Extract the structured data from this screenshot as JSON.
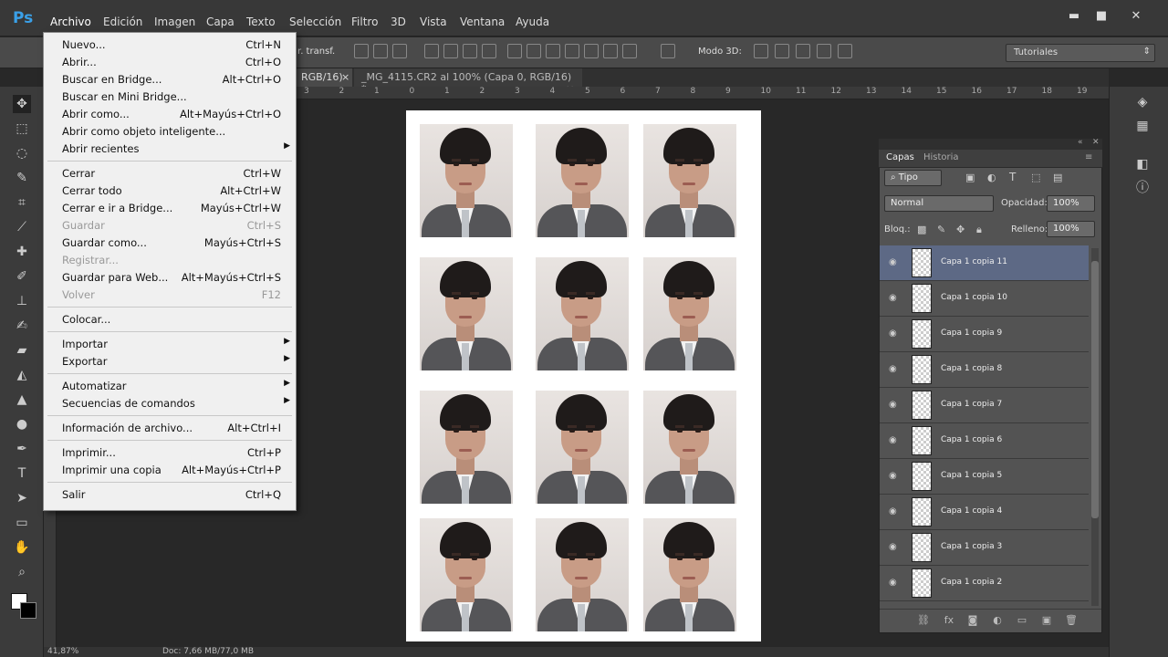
{
  "app": {
    "logo": "Ps",
    "menu": [
      "Archivo",
      "Edición",
      "Imagen",
      "Capa",
      "Texto",
      "Selección",
      "Filtro",
      "3D",
      "Vista",
      "Ventana",
      "Ayuda"
    ],
    "window_controls": {
      "minimize": "▬",
      "restore": "■",
      "close": "✕"
    }
  },
  "options": {
    "transform_label": "r. transf.",
    "mode3d_label": "Modo 3D:",
    "workspace": "Tutoriales"
  },
  "tabs": [
    {
      "label": "RGB/16)",
      "close": "×"
    },
    {
      "label": "_MG_4115.CR2 al 100% (Capa 0, RGB/16) *",
      "close": "×"
    }
  ],
  "ruler": {
    "ticks": [
      "3",
      "2",
      "1",
      "0",
      "1",
      "2",
      "3",
      "4",
      "5",
      "6",
      "7",
      "8",
      "9",
      "10",
      "11",
      "12",
      "13",
      "14",
      "15",
      "16",
      "17",
      "18",
      "19"
    ]
  },
  "file_menu": {
    "groups": [
      [
        {
          "label": "Nuevo...",
          "shortcut": "Ctrl+N"
        },
        {
          "label": "Abrir...",
          "shortcut": "Ctrl+O"
        },
        {
          "label": "Buscar en Bridge...",
          "shortcut": "Alt+Ctrl+O"
        },
        {
          "label": "Buscar en Mini Bridge...",
          "shortcut": ""
        },
        {
          "label": "Abrir como...",
          "shortcut": "Alt+Mayús+Ctrl+O"
        },
        {
          "label": "Abrir como objeto inteligente...",
          "shortcut": ""
        },
        {
          "label": "Abrir recientes",
          "shortcut": "",
          "submenu": true
        }
      ],
      [
        {
          "label": "Cerrar",
          "shortcut": "Ctrl+W"
        },
        {
          "label": "Cerrar todo",
          "shortcut": "Alt+Ctrl+W"
        },
        {
          "label": "Cerrar e ir a Bridge...",
          "shortcut": "Mayús+Ctrl+W"
        },
        {
          "label": "Guardar",
          "shortcut": "Ctrl+S",
          "disabled": true
        },
        {
          "label": "Guardar como...",
          "shortcut": "Mayús+Ctrl+S"
        },
        {
          "label": "Registrar...",
          "shortcut": "",
          "disabled": true
        },
        {
          "label": "Guardar para Web...",
          "shortcut": "Alt+Mayús+Ctrl+S"
        },
        {
          "label": "Volver",
          "shortcut": "F12",
          "disabled": true
        }
      ],
      [
        {
          "label": "Colocar...",
          "shortcut": ""
        }
      ],
      [
        {
          "label": "Importar",
          "shortcut": "",
          "submenu": true
        },
        {
          "label": "Exportar",
          "shortcut": "",
          "submenu": true
        }
      ],
      [
        {
          "label": "Automatizar",
          "shortcut": "",
          "submenu": true
        },
        {
          "label": "Secuencias de comandos",
          "shortcut": "",
          "submenu": true
        }
      ],
      [
        {
          "label": "Información de archivo...",
          "shortcut": "Alt+Ctrl+I"
        }
      ],
      [
        {
          "label": "Imprimir...",
          "shortcut": "Ctrl+P"
        },
        {
          "label": "Imprimir una copia",
          "shortcut": "Alt+Mayús+Ctrl+P"
        }
      ],
      [
        {
          "label": "Salir",
          "shortcut": "Ctrl+Q"
        }
      ]
    ]
  },
  "layers_panel": {
    "tabs": [
      "Capas",
      "Historia"
    ],
    "filter": "Tipo",
    "blend_mode": "Normal",
    "opacity_label": "Opacidad:",
    "opacity": "100%",
    "lock_label": "Bloq.:",
    "fill_label": "Relleno:",
    "fill": "100%",
    "layers": [
      "Capa 1 copia 11",
      "Capa 1 copia 10",
      "Capa 1 copia 9",
      "Capa 1 copia 8",
      "Capa 1 copia 7",
      "Capa 1 copia 6",
      "Capa 1 copia 5",
      "Capa 1 copia 4",
      "Capa 1 copia 3",
      "Capa 1 copia 2"
    ],
    "selected_layer": "Capa 1 copia 11"
  },
  "status": {
    "zoom": "41,87%",
    "doc": "Doc: 7,66 MB/77,0 MB"
  },
  "colors": {
    "accent": "#3aa0e8",
    "selected_row": "#5d6985"
  },
  "photos_grid": {
    "rows": 4,
    "cols": 3
  }
}
